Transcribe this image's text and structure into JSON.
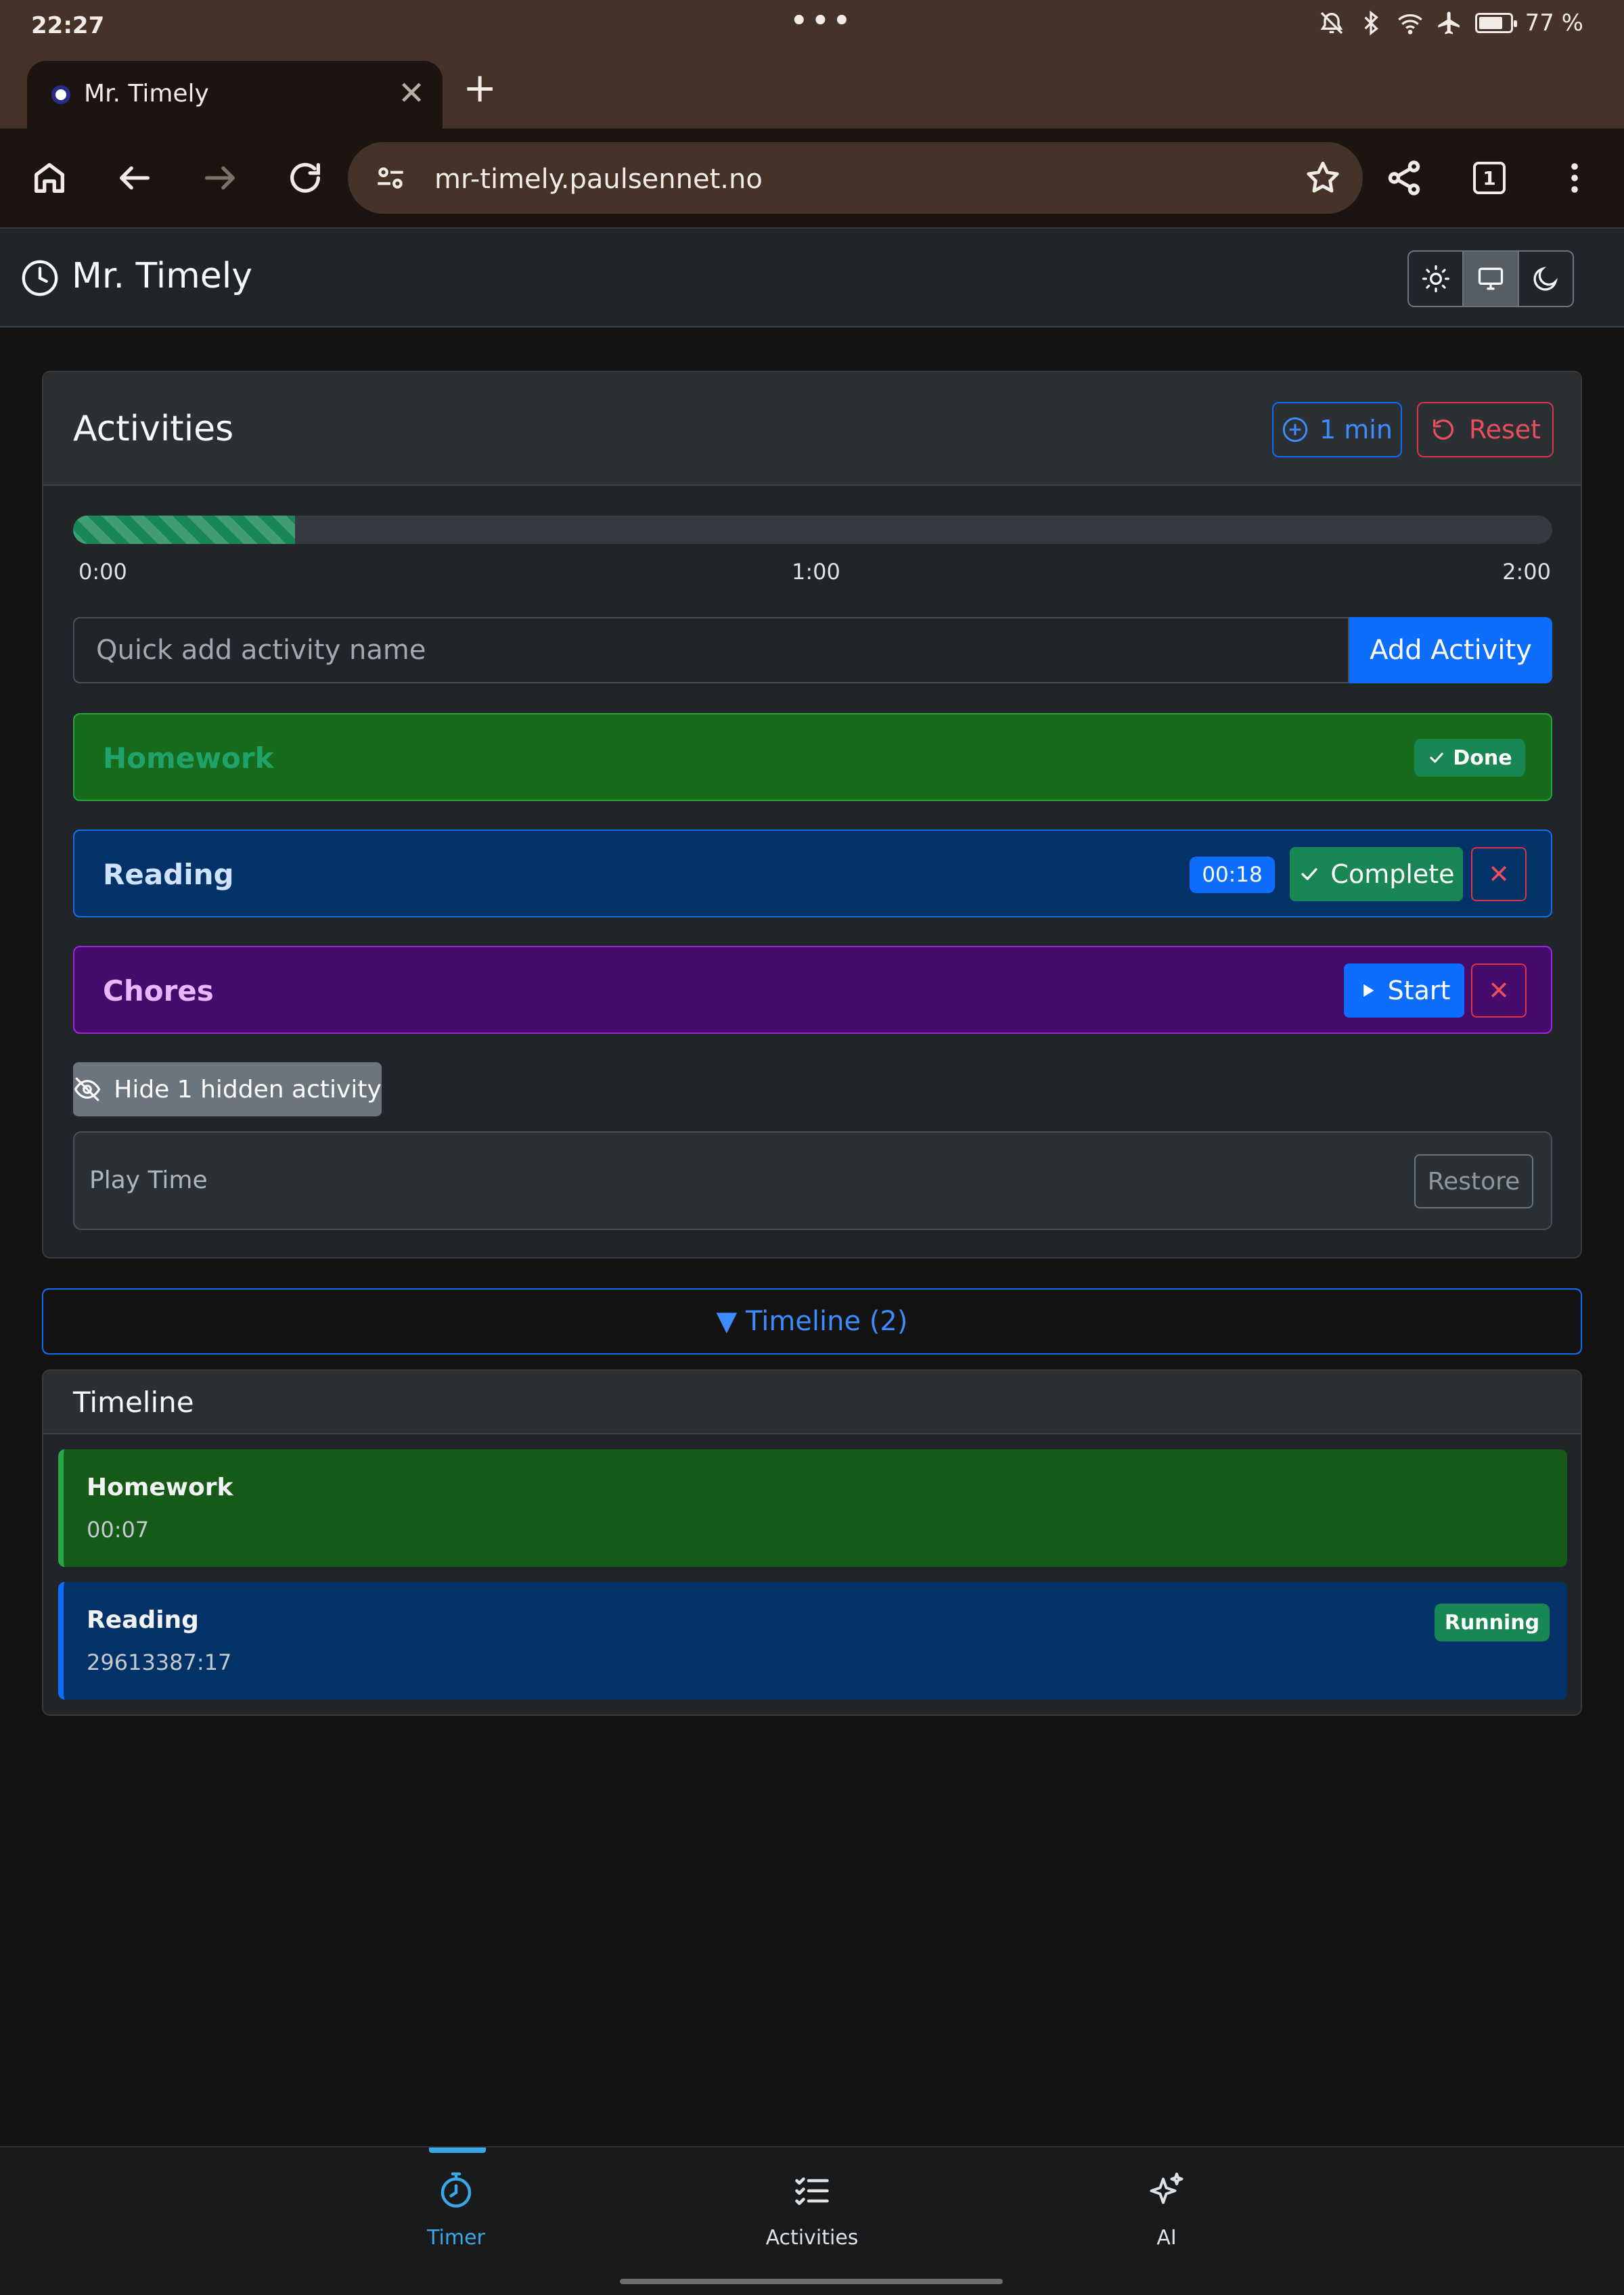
{
  "status_bar": {
    "time": "22:27",
    "dots": "•••",
    "battery": "77 %"
  },
  "browser": {
    "tab_title": "Mr. Timely",
    "tab_close": "✕",
    "new_tab": "+",
    "url": "mr-timely.paulsennet.no",
    "tab_count": "1"
  },
  "app": {
    "title": "Mr. Timely",
    "theme_modes": [
      "light",
      "system",
      "dark"
    ],
    "theme_selected": "system"
  },
  "activities_card": {
    "title": "Activities",
    "add_minute_label": "1 min",
    "reset_label": "Reset",
    "progress": {
      "fraction": 0.15,
      "ticks": [
        "0:00",
        "1:00",
        "2:00"
      ]
    },
    "quick_add_placeholder": "Quick add activity name",
    "add_button_label": "Add Activity",
    "items": [
      {
        "name": "Homework",
        "status": "done",
        "badge": "Done",
        "color": "#176b1c"
      },
      {
        "name": "Reading",
        "status": "running",
        "timer": "00:18",
        "complete_label": "Complete",
        "remove_label": "✕",
        "color": "#033269"
      },
      {
        "name": "Chores",
        "status": "idle",
        "start_label": "Start",
        "remove_label": "✕",
        "color": "#450a6b"
      }
    ],
    "hide_toggle_label": "Hide 1 hidden activity",
    "hidden_items": [
      {
        "name": "Play Time",
        "restore_label": "Restore"
      }
    ]
  },
  "timeline_toggle": {
    "label": "▼ Timeline (2)"
  },
  "timeline": {
    "title": "Timeline",
    "entries": [
      {
        "name": "Homework",
        "duration": "00:07"
      },
      {
        "name": "Reading",
        "duration": "29613387:17",
        "badge": "Running"
      }
    ]
  },
  "bottom_nav": {
    "items": [
      {
        "label": "Timer",
        "active": true
      },
      {
        "label": "Activities",
        "active": false
      },
      {
        "label": "AI",
        "active": false
      }
    ]
  },
  "colors": {
    "primary": "#0d6efd",
    "success": "#198754",
    "danger": "#dc3545",
    "secondary": "#6c757d",
    "nav_active": "#3aa7e8"
  }
}
